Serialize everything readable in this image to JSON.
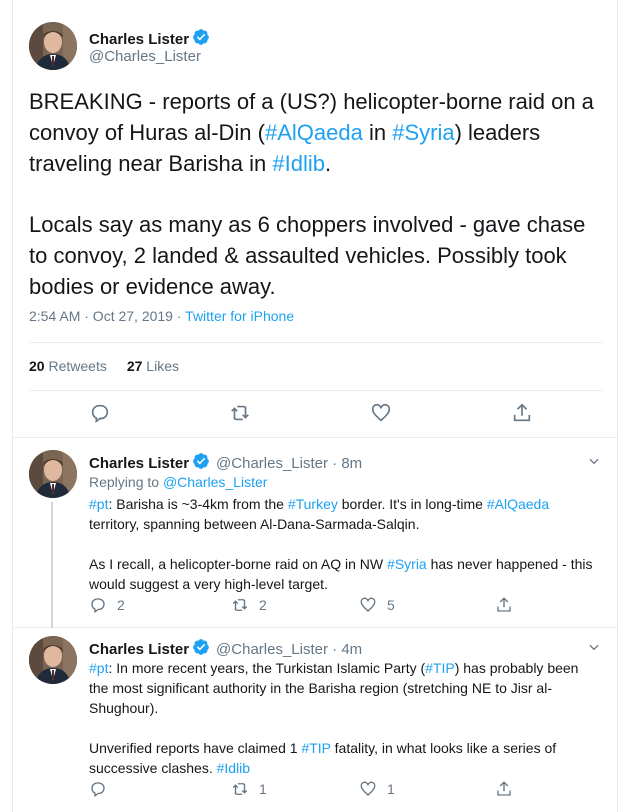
{
  "main_tweet": {
    "author_name": "Charles Lister",
    "author_handle": "@Charles_Lister",
    "paragraph1": [
      {
        "t": "BREAKING - reports of a (US?) helicopter-borne raid on a convoy of Huras al-Din (",
        "link": false
      },
      {
        "t": "#AlQaeda",
        "link": true
      },
      {
        "t": " in ",
        "link": false
      },
      {
        "t": "#Syria",
        "link": true
      },
      {
        "t": ") leaders traveling near Barisha in ",
        "link": false
      },
      {
        "t": "#Idlib",
        "link": true
      },
      {
        "t": ".",
        "link": false
      }
    ],
    "paragraph2": "Locals say as many as 6 choppers involved - gave chase to convoy, 2 landed & assaulted vehicles. Possibly took bodies or evidence away.",
    "timestamp": "2:54 AM · Oct 27, 2019 · ",
    "source": "Twitter for iPhone",
    "retweets_count": "20",
    "retweets_label": "Retweets",
    "likes_count": "27",
    "likes_label": "Likes"
  },
  "replies": [
    {
      "author_name": "Charles Lister",
      "author_handle": "@Charles_Lister · 8m",
      "replying_prefix": "Replying to ",
      "replying_handle": "@Charles_Lister",
      "paragraph1": [
        {
          "t": "#pt",
          "link": true
        },
        {
          "t": ": Barisha is ~3-4km from the ",
          "link": false
        },
        {
          "t": "#Turkey",
          "link": true
        },
        {
          "t": " border. It's in long-time ",
          "link": false
        },
        {
          "t": "#AlQaeda",
          "link": true
        },
        {
          "t": " territory, spanning between Al-Dana-Sarmada-Salqin.",
          "link": false
        }
      ],
      "paragraph2": [
        {
          "t": "As I recall, a helicopter-borne raid on AQ in NW ",
          "link": false
        },
        {
          "t": "#Syria",
          "link": true
        },
        {
          "t": " has never happened - this would suggest a very high-level target.",
          "link": false
        }
      ],
      "reply_count": "2",
      "retweet_count": "2",
      "like_count": "5"
    },
    {
      "author_name": "Charles Lister",
      "author_handle": "@Charles_Lister · 4m",
      "paragraph1": [
        {
          "t": "#pt",
          "link": true
        },
        {
          "t": ": In more recent years, the Turkistan Islamic Party (",
          "link": false
        },
        {
          "t": "#TIP",
          "link": true
        },
        {
          "t": ") has probably been the most significant authority in the Barisha region (stretching NE to Jisr al-Shughour).",
          "link": false
        }
      ],
      "paragraph2": [
        {
          "t": "Unverified reports have claimed 1 ",
          "link": false
        },
        {
          "t": "#TIP",
          "link": true
        },
        {
          "t": " fatality, in what looks like a series of successive clashes. ",
          "link": false
        },
        {
          "t": "#Idlib",
          "link": true
        }
      ],
      "reply_count": "",
      "retweet_count": "1",
      "like_count": "1"
    }
  ],
  "icons": {
    "reply": "reply-icon",
    "retweet": "retweet-icon",
    "like": "heart-icon",
    "share": "share-icon",
    "verified": "verified-badge-icon",
    "more": "chevron-down-icon"
  },
  "colors": {
    "link": "#1da1f2",
    "secondary_text": "#657786",
    "border": "#e6ecf0"
  }
}
